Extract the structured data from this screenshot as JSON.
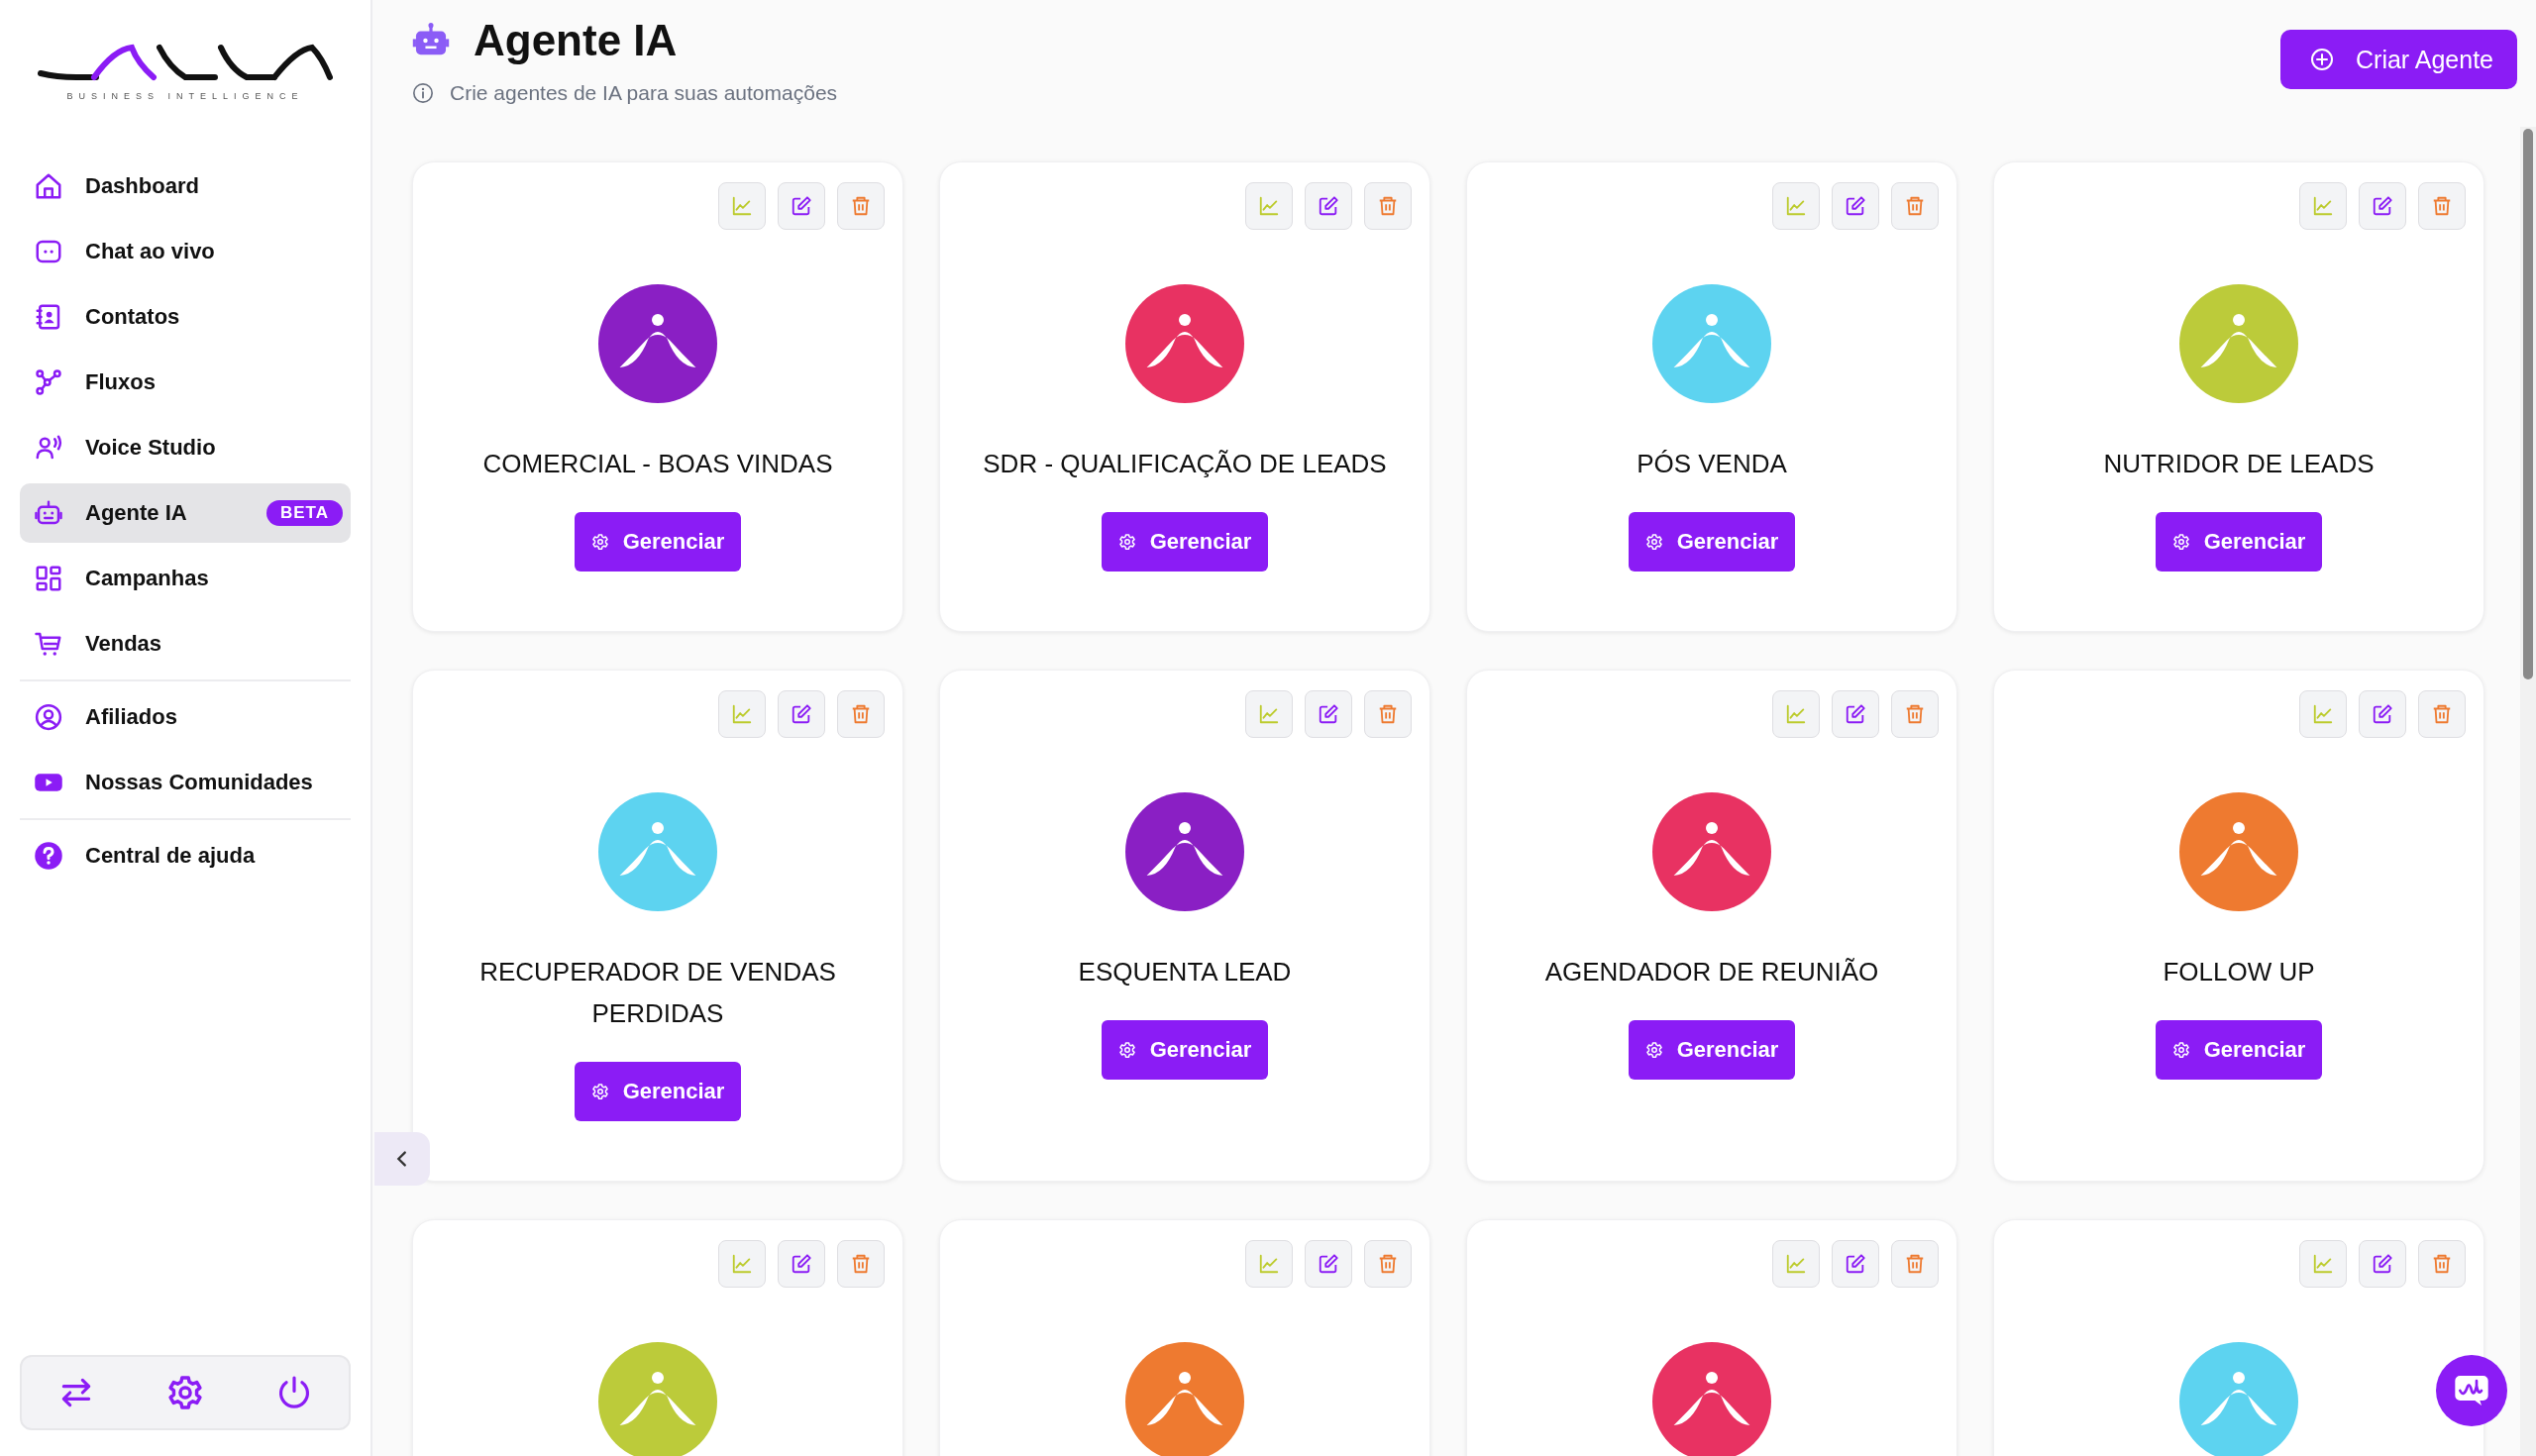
{
  "sidebar": {
    "brand_tagline": "BUSINESS INTELLIGENCE",
    "sections": [
      [
        {
          "label": "Dashboard",
          "selected": false
        },
        {
          "label": "Chat ao vivo",
          "selected": false
        },
        {
          "label": "Contatos",
          "selected": false
        },
        {
          "label": "Fluxos",
          "selected": false
        },
        {
          "label": "Voice Studio",
          "selected": false
        },
        {
          "label": "Agente IA",
          "selected": true,
          "badge": "BETA"
        },
        {
          "label": "Campanhas",
          "selected": false
        },
        {
          "label": "Vendas",
          "selected": false
        }
      ],
      [
        {
          "label": "Afiliados",
          "selected": false
        },
        {
          "label": "Nossas Comunidades",
          "selected": false
        }
      ],
      [
        {
          "label": "Central de ajuda",
          "selected": false
        }
      ]
    ]
  },
  "header": {
    "title": "Agente IA",
    "subtitle": "Crie agentes de IA para suas automações",
    "create_button": "Criar Agente"
  },
  "agents": [
    {
      "name": "COMERCIAL - BOAS VINDAS",
      "color": "#8a1fc4",
      "button": "Gerenciar"
    },
    {
      "name": "SDR - QUALIFICAÇÃO DE LEADS",
      "color": "#e83262",
      "button": "Gerenciar"
    },
    {
      "name": "PÓS VENDA",
      "color": "#5dd3f0",
      "button": "Gerenciar"
    },
    {
      "name": "NUTRIDOR DE LEADS",
      "color": "#bccb3a",
      "button": "Gerenciar"
    },
    {
      "name": "RECUPERADOR DE VENDAS PERDIDAS",
      "color": "#5dd3f0",
      "button": "Gerenciar"
    },
    {
      "name": "ESQUENTA LEAD",
      "color": "#8a1fc4",
      "button": "Gerenciar"
    },
    {
      "name": "AGENDADOR DE REUNIÃO",
      "color": "#e83262",
      "button": "Gerenciar"
    },
    {
      "name": "FOLLOW UP",
      "color": "#ee7a30",
      "button": "Gerenciar"
    },
    {
      "color": "#bccb3a"
    },
    {
      "color": "#ee7a30"
    },
    {
      "color": "#e83262"
    },
    {
      "color": "#5dd3f0"
    }
  ]
}
